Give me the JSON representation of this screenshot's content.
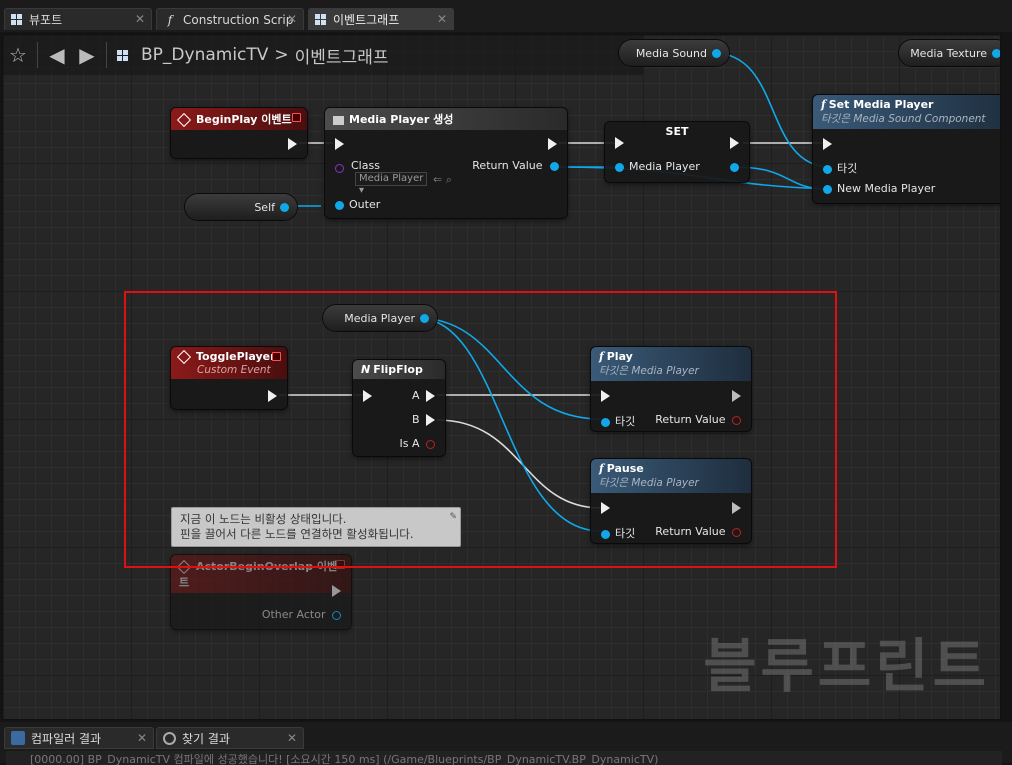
{
  "tabs": [
    {
      "label": "뷰포트",
      "icon": "viewport-icon"
    },
    {
      "label": "Construction Scrip",
      "icon": "function-icon"
    },
    {
      "label": "이벤트그래프",
      "icon": "event-graph-icon"
    }
  ],
  "breadcrumb": {
    "blueprint": "BP_DynamicTV",
    "separator": ">",
    "graph": "이벤트그래프"
  },
  "nodes": {
    "media_sound": {
      "label": "Media Sound"
    },
    "media_texture": {
      "label": "Media Texture"
    },
    "begin_play": {
      "title": "BeginPlay 이벤트"
    },
    "create_media_player": {
      "title": "Media Player 생성",
      "class_label": "Class",
      "class_value": "Media Player",
      "return_label": "Return Value",
      "outer_label": "Outer"
    },
    "self": {
      "label": "Self"
    },
    "set": {
      "title": "SET",
      "pin": "Media Player"
    },
    "set_media_player": {
      "title": "Set Media Player",
      "subtitle": "타깃은 Media Sound Component",
      "target": "타깃",
      "new_media_player": "New Media Player"
    },
    "media_player_var": {
      "label": "Media Player"
    },
    "toggle_player": {
      "title": "TogglePlayer",
      "subtitle": "Custom Event"
    },
    "flipflop": {
      "title": "FlipFlop",
      "a": "A",
      "b": "B",
      "is_a": "Is A"
    },
    "play": {
      "title": "Play",
      "subtitle": "타깃은 Media Player",
      "target": "타깃",
      "return": "Return Value"
    },
    "pause": {
      "title": "Pause",
      "subtitle": "타깃은 Media Player",
      "target": "타깃",
      "return": "Return Value"
    },
    "actor_overlap": {
      "title": "ActorBeginOverlap 이벤트",
      "other_actor": "Other Actor"
    }
  },
  "tooltip": {
    "line1": "지금 이 노드는 비활성 상태입니다.",
    "line2": "핀을 끌어서 다른 노드를 연결하면 활성화됩니다."
  },
  "watermark": "블루프린트",
  "bottom_tabs": [
    {
      "label": "컴파일러 결과"
    },
    {
      "label": "찾기 결과"
    }
  ],
  "log": "[0000.00] BP_DynamicTV 컴파일에 성공했습니다! [소요시간 150 ms] (/Game/Blueprints/BP_DynamicTV.BP_DynamicTV)"
}
